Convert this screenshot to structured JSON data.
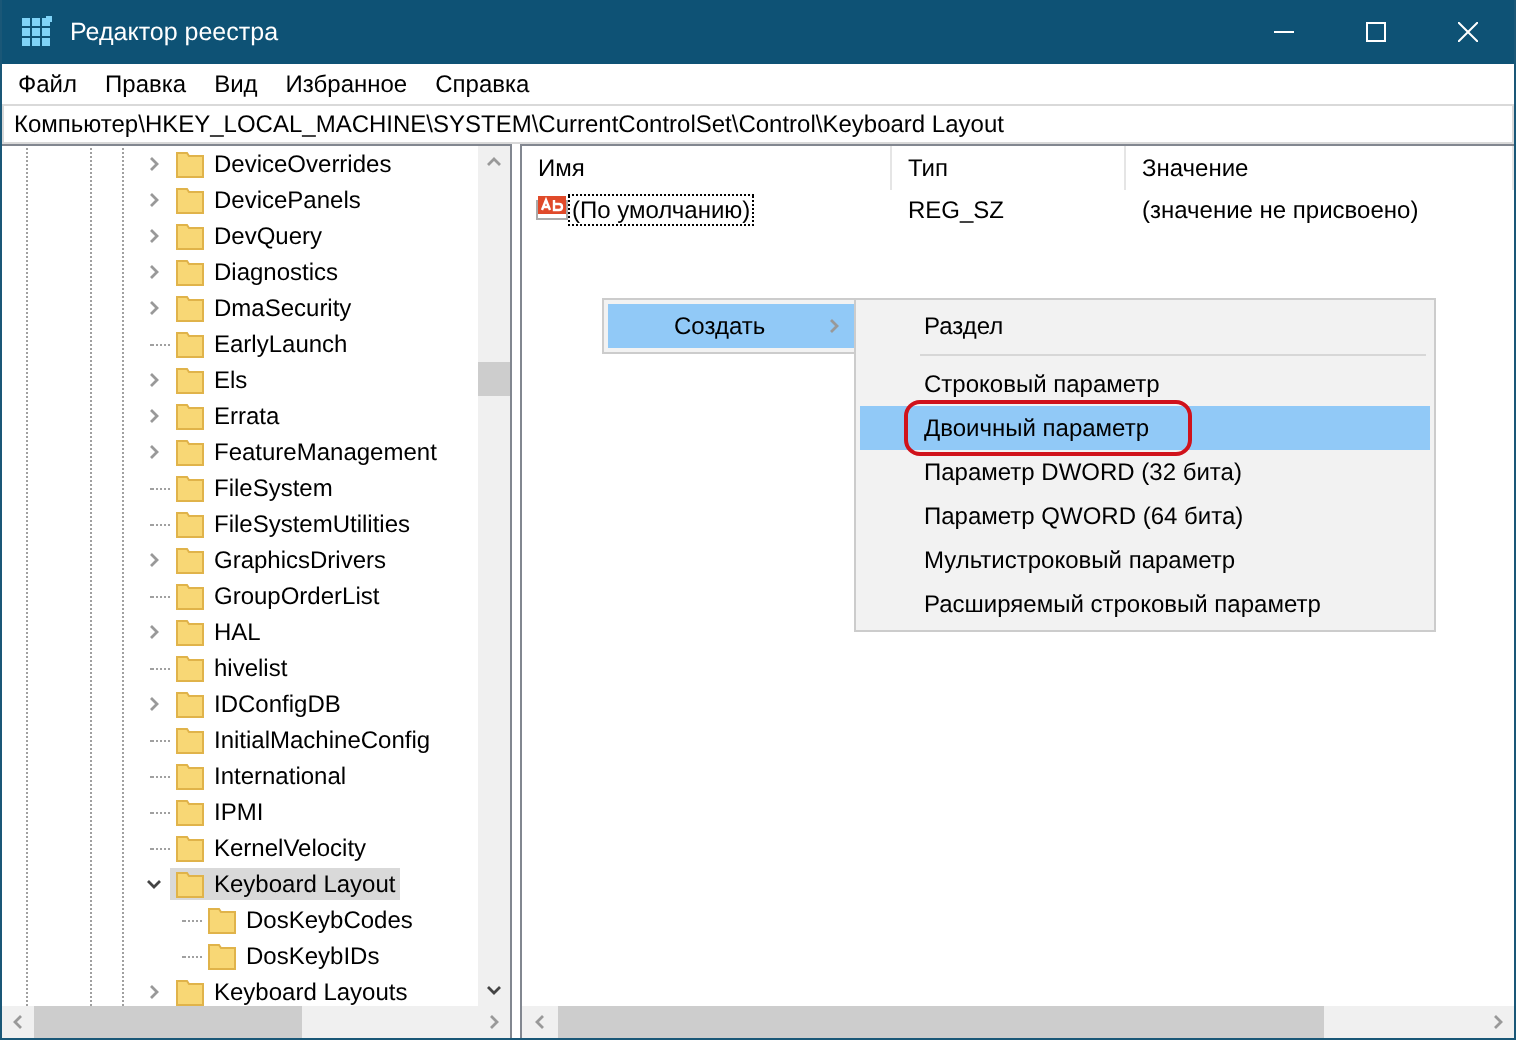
{
  "window": {
    "title": "Редактор реестра"
  },
  "menu": [
    "Файл",
    "Правка",
    "Вид",
    "Избранное",
    "Справка"
  ],
  "address": "Компьютер\\HKEY_LOCAL_MACHINE\\SYSTEM\\CurrentControlSet\\Control\\Keyboard Layout",
  "tree": [
    {
      "label": "DeviceOverrides",
      "expandable": true,
      "expanded": false,
      "selected": false
    },
    {
      "label": "DevicePanels",
      "expandable": true,
      "expanded": false,
      "selected": false
    },
    {
      "label": "DevQuery",
      "expandable": true,
      "expanded": false,
      "selected": false
    },
    {
      "label": "Diagnostics",
      "expandable": true,
      "expanded": false,
      "selected": false
    },
    {
      "label": "DmaSecurity",
      "expandable": true,
      "expanded": false,
      "selected": false
    },
    {
      "label": "EarlyLaunch",
      "expandable": false,
      "selected": false
    },
    {
      "label": "Els",
      "expandable": true,
      "expanded": false,
      "selected": false
    },
    {
      "label": "Errata",
      "expandable": true,
      "expanded": false,
      "selected": false
    },
    {
      "label": "FeatureManagement",
      "expandable": true,
      "expanded": false,
      "selected": false
    },
    {
      "label": "FileSystem",
      "expandable": false,
      "selected": false
    },
    {
      "label": "FileSystemUtilities",
      "expandable": false,
      "selected": false
    },
    {
      "label": "GraphicsDrivers",
      "expandable": true,
      "expanded": false,
      "selected": false
    },
    {
      "label": "GroupOrderList",
      "expandable": false,
      "selected": false
    },
    {
      "label": "HAL",
      "expandable": true,
      "expanded": false,
      "selected": false
    },
    {
      "label": "hivelist",
      "expandable": false,
      "selected": false
    },
    {
      "label": "IDConfigDB",
      "expandable": true,
      "expanded": false,
      "selected": false
    },
    {
      "label": "InitialMachineConfig",
      "expandable": false,
      "selected": false
    },
    {
      "label": "International",
      "expandable": false,
      "selected": false
    },
    {
      "label": "IPMI",
      "expandable": false,
      "selected": false
    },
    {
      "label": "KernelVelocity",
      "expandable": false,
      "selected": false
    },
    {
      "label": "Keyboard Layout",
      "expandable": true,
      "expanded": true,
      "selected": true,
      "children": [
        {
          "label": "DosKeybCodes",
          "expandable": false,
          "selected": false
        },
        {
          "label": "DosKeybIDs",
          "expandable": false,
          "selected": false
        }
      ]
    },
    {
      "label": "Keyboard Layouts",
      "expandable": true,
      "expanded": false,
      "selected": false
    }
  ],
  "list": {
    "columns": [
      "Имя",
      "Тип",
      "Значение"
    ],
    "rows": [
      {
        "name": "(По умолчанию)",
        "type": "REG_SZ",
        "value": "(значение не присвоено)",
        "focused": true
      }
    ]
  },
  "context_menu": {
    "items": [
      {
        "label": "Создать",
        "has_submenu": true,
        "selected": true
      }
    ]
  },
  "submenu": {
    "items": [
      {
        "label": "Раздел",
        "selected": false,
        "circled": false,
        "separator_after": true
      },
      {
        "label": "Строковый параметр",
        "selected": false,
        "circled": false,
        "separator_after": false
      },
      {
        "label": "Двоичный параметр",
        "selected": true,
        "circled": true,
        "separator_after": false
      },
      {
        "label": "Параметр DWORD (32 бита)",
        "selected": false,
        "circled": false,
        "separator_after": false
      },
      {
        "label": "Параметр QWORD (64 бита)",
        "selected": false,
        "circled": false,
        "separator_after": false
      },
      {
        "label": "Мультистроковый параметр",
        "selected": false,
        "circled": false,
        "separator_after": false
      },
      {
        "label": "Расширяемый строковый параметр",
        "selected": false,
        "circled": false,
        "separator_after": false
      }
    ]
  }
}
